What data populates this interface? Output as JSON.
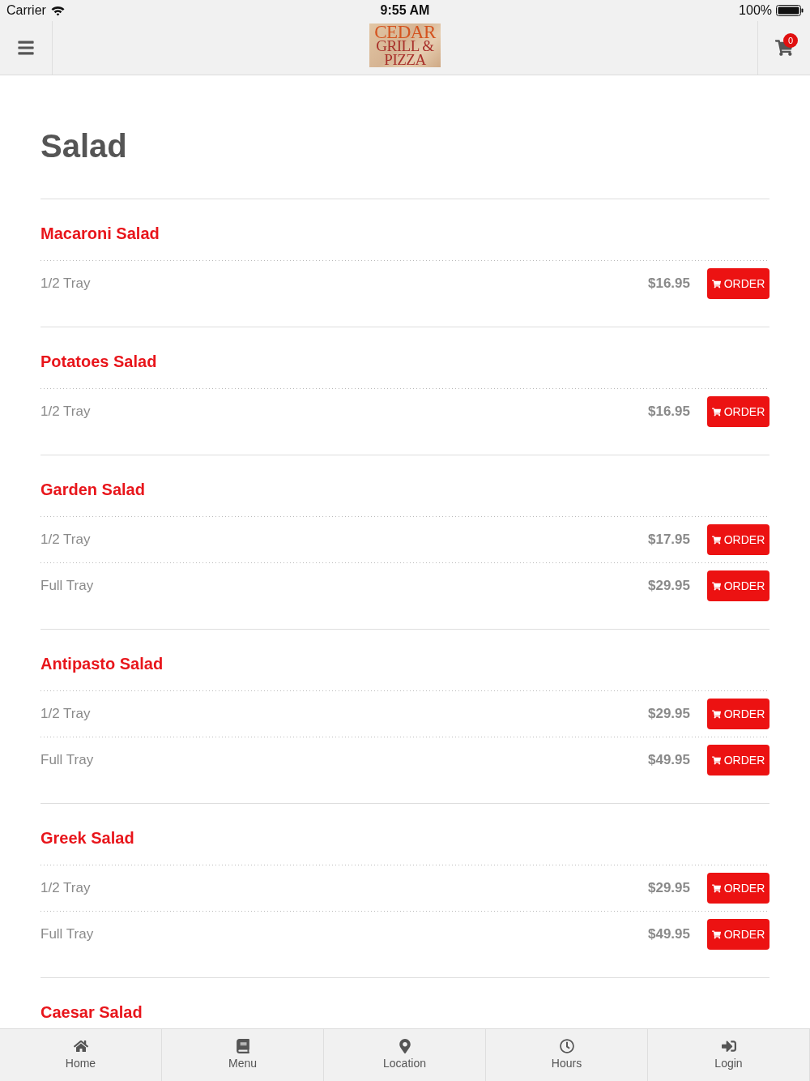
{
  "status_bar": {
    "carrier": "Carrier",
    "time": "9:55 AM",
    "battery": "100%"
  },
  "header": {
    "logo_lines": [
      "CEDAR",
      "GRILL &",
      "PIZZA"
    ],
    "cart_count": "0"
  },
  "page_title": "Salad",
  "sections": [
    {
      "title": "Macaroni Salad",
      "options": [
        {
          "size": "1/2 Tray",
          "price": "$16.95",
          "button": "ORDER"
        }
      ]
    },
    {
      "title": "Potatoes Salad",
      "options": [
        {
          "size": "1/2 Tray",
          "price": "$16.95",
          "button": "ORDER"
        }
      ]
    },
    {
      "title": "Garden Salad",
      "options": [
        {
          "size": "1/2 Tray",
          "price": "$17.95",
          "button": "ORDER"
        },
        {
          "size": "Full Tray",
          "price": "$29.95",
          "button": "ORDER"
        }
      ]
    },
    {
      "title": "Antipasto Salad",
      "options": [
        {
          "size": "1/2 Tray",
          "price": "$29.95",
          "button": "ORDER"
        },
        {
          "size": "Full Tray",
          "price": "$49.95",
          "button": "ORDER"
        }
      ]
    },
    {
      "title": "Greek Salad",
      "options": [
        {
          "size": "1/2 Tray",
          "price": "$29.95",
          "button": "ORDER"
        },
        {
          "size": "Full Tray",
          "price": "$49.95",
          "button": "ORDER"
        }
      ]
    },
    {
      "title": "Caesar Salad"
    }
  ],
  "tab_bar": [
    {
      "label": "Home",
      "kind": "home"
    },
    {
      "label": "Menu",
      "kind": "menu"
    },
    {
      "label": "Location",
      "kind": "location"
    },
    {
      "label": "Hours",
      "kind": "hours"
    },
    {
      "label": "Login",
      "kind": "login"
    }
  ]
}
